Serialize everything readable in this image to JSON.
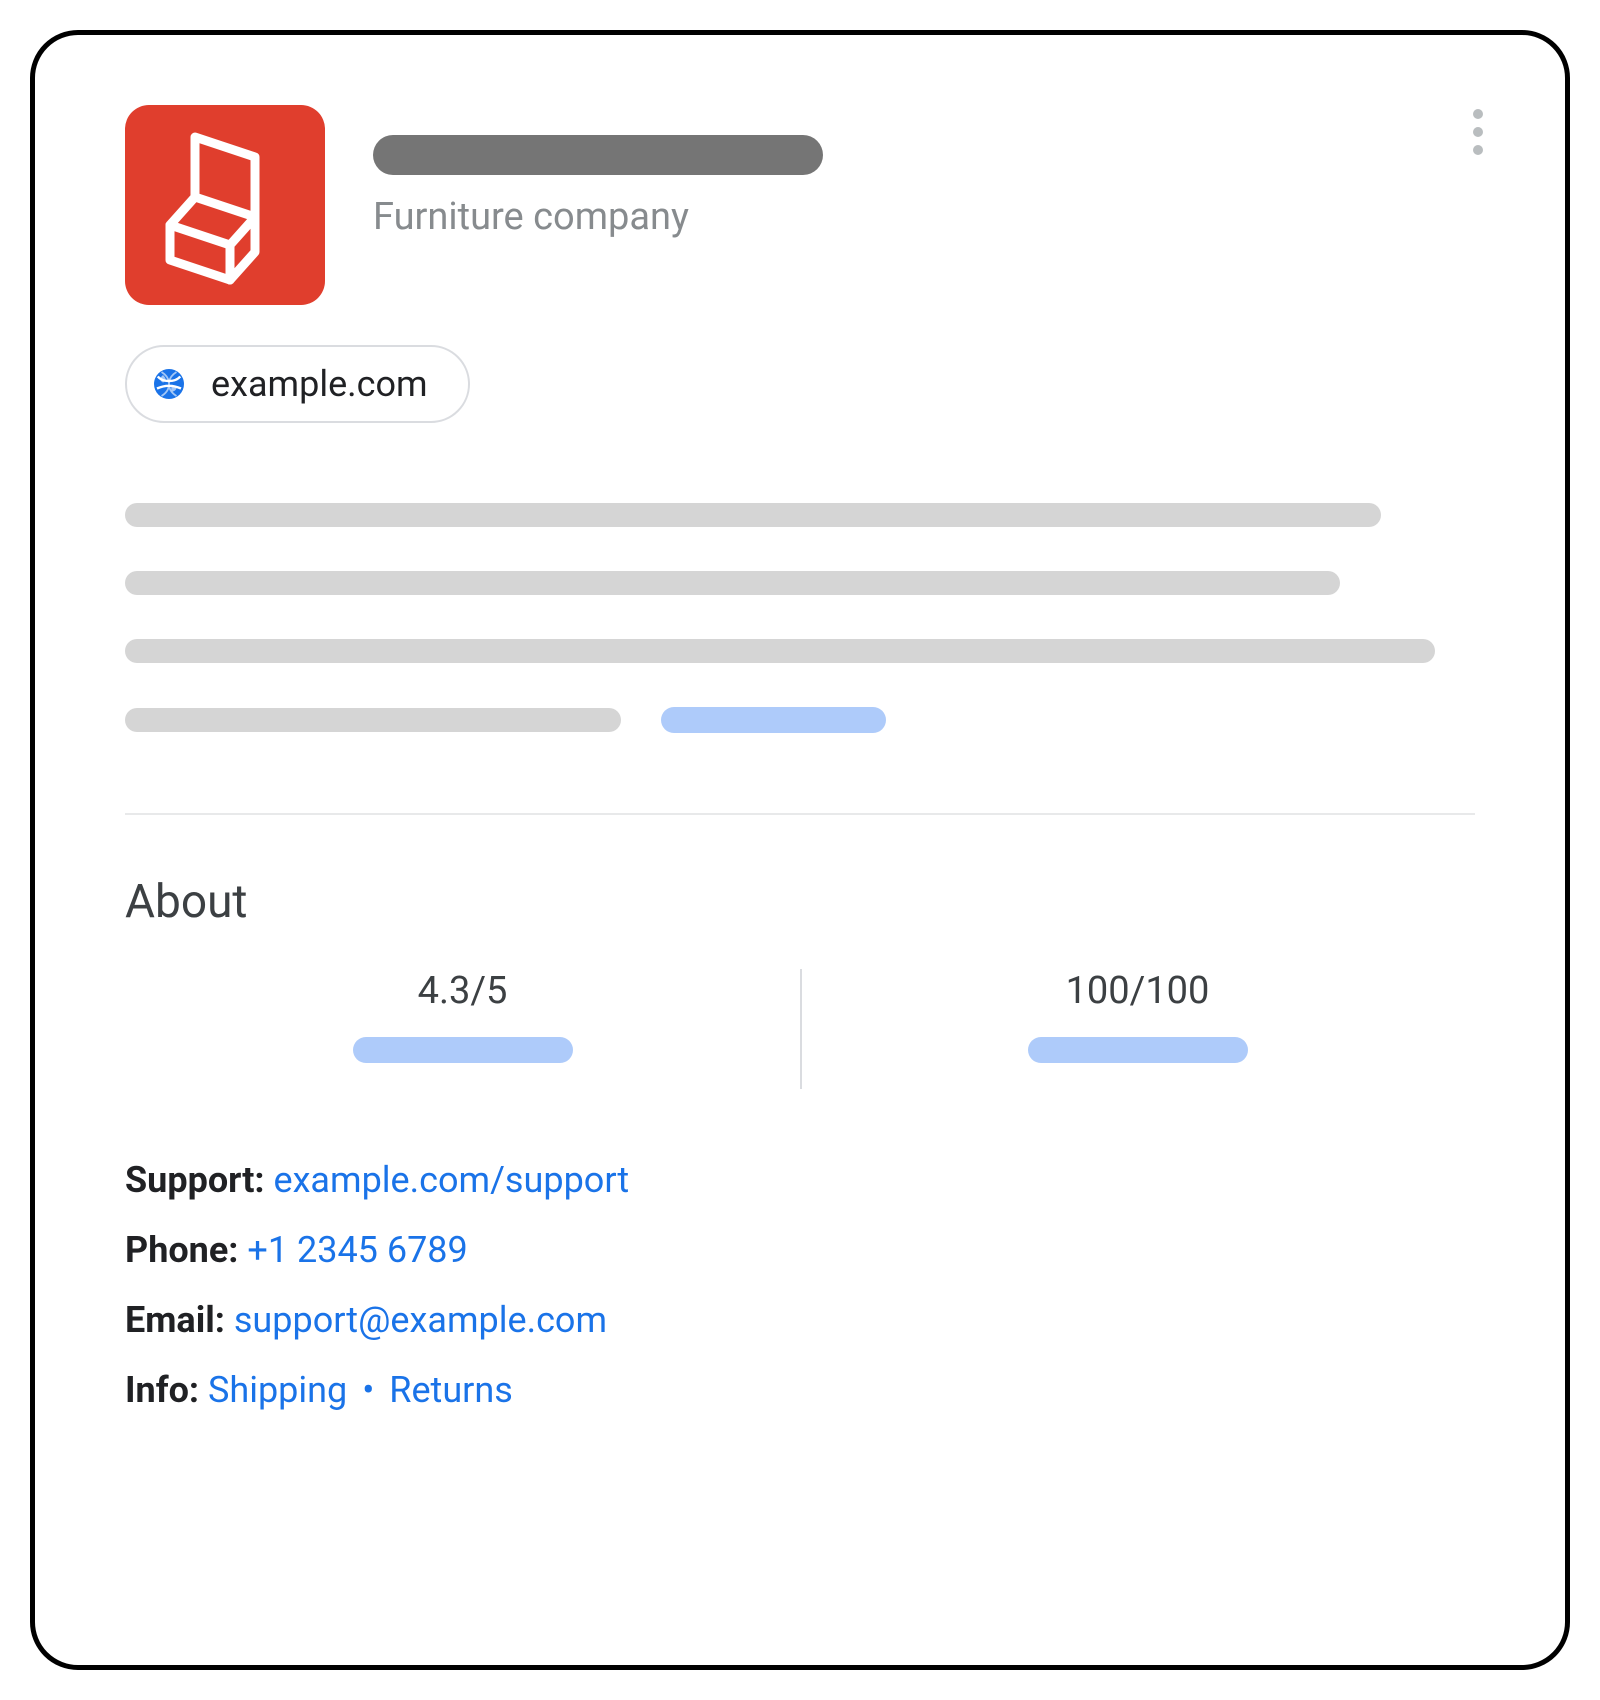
{
  "header": {
    "subtitle": "Furniture company",
    "website": "example.com"
  },
  "about": {
    "heading": "About",
    "rating": "4.3/5",
    "score": "100/100"
  },
  "contact": {
    "support_label": "Support:",
    "support_value": "example.com/support",
    "phone_label": "Phone:",
    "phone_value": "+1 2345 6789",
    "email_label": "Email:",
    "email_value": "support@example.com",
    "info_label": "Info:",
    "info_shipping": "Shipping",
    "info_sep": "•",
    "info_returns": "Returns"
  }
}
